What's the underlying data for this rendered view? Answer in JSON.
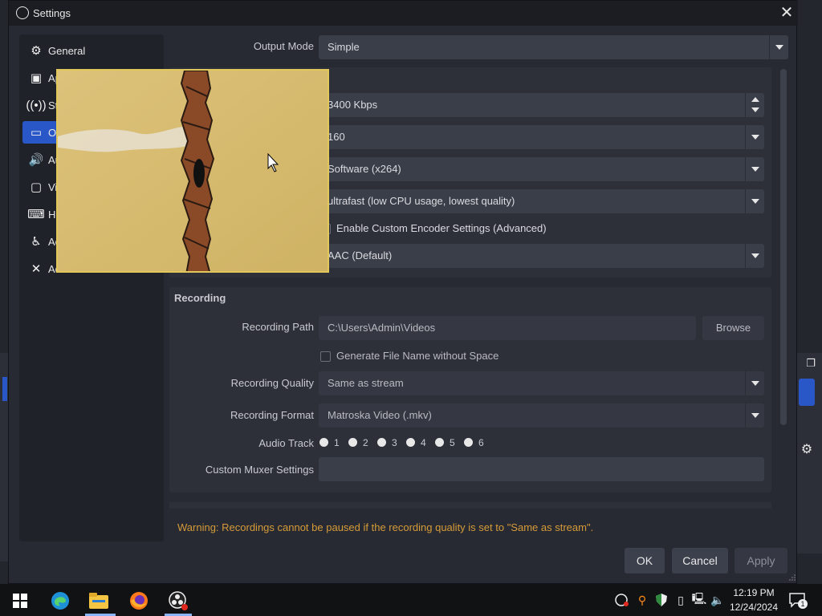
{
  "window": {
    "title": "Settings",
    "close_glyph": "✕"
  },
  "sidebar": {
    "items": [
      {
        "label": "General",
        "icon": "gear-icon"
      },
      {
        "label": "Ap",
        "icon": "appearance-icon"
      },
      {
        "label": "St",
        "icon": "stream-antenna-icon"
      },
      {
        "label": "Ou",
        "icon": "output-icon",
        "active": true
      },
      {
        "label": "Au",
        "icon": "speaker-icon"
      },
      {
        "label": "Vi",
        "icon": "monitor-icon"
      },
      {
        "label": "Ho",
        "icon": "keyboard-icon"
      },
      {
        "label": "Ac",
        "icon": "accessibility-icon"
      },
      {
        "label": "Ad",
        "icon": "tools-icon"
      }
    ]
  },
  "output": {
    "mode_label": "Output Mode",
    "mode_value": "Simple",
    "streaming": {
      "video_bitrate": "3400 Kbps",
      "audio_bitrate": "160",
      "encoder": "Software (x264)",
      "preset": "ultrafast (low CPU usage, lowest quality)",
      "custom_encoder_label": "Enable Custom Encoder Settings (Advanced)",
      "audio_encoder": "AAC (Default)"
    },
    "recording": {
      "section_title": "Recording",
      "path_label": "Recording Path",
      "path_value": "C:\\Users\\Admin\\Videos",
      "browse_label": "Browse",
      "gen_filename_label": "Generate File Name without Space",
      "quality_label": "Recording Quality",
      "quality_value": "Same as stream",
      "format_label": "Recording Format",
      "format_value": "Matroska Video (.mkv)",
      "audio_track_label": "Audio Track",
      "tracks": [
        "1",
        "2",
        "3",
        "4",
        "5",
        "6"
      ],
      "muxer_label": "Custom Muxer Settings",
      "muxer_value": ""
    },
    "warning": "Warning: Recordings cannot be paused if the recording quality is set to \"Same as stream\"."
  },
  "buttons": {
    "ok": "OK",
    "cancel": "Cancel",
    "apply": "Apply"
  },
  "taskbar": {
    "time": "12:19 PM",
    "date": "12/24/2024",
    "notification_count": "1",
    "apps": [
      "windows-start-icon",
      "edge-icon",
      "file-explorer-icon",
      "firefox-icon",
      "obs-icon"
    ],
    "tray_icons": [
      "obs-tray-icon",
      "search-tray-icon",
      "shield-icon",
      "usb-icon",
      "network-icon",
      "volume-icon"
    ]
  },
  "colors": {
    "accent": "#2a57c7",
    "warning": "#d69b38",
    "preview_border": "#e2c75a"
  }
}
